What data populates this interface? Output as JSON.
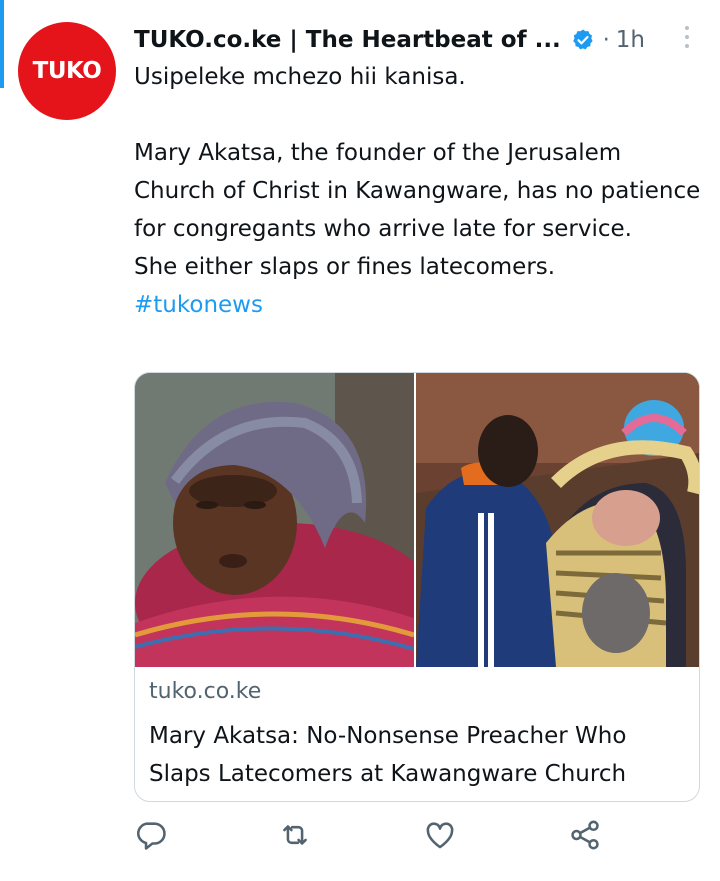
{
  "tweet": {
    "author": "TUKO.co.ke | The Heartbeat of ...",
    "avatar_text": "TUKO",
    "dot": "·",
    "time": "1h",
    "lines": [
      "Usipeleke mchezo hii kanisa.",
      "Mary Akatsa, the founder of the Jerusalem Church of Christ in Kawangware, has no patience for congregants who arrive late for service.",
      "She either slaps or fines latecomers."
    ],
    "hashtag": "#tukonews"
  },
  "card": {
    "domain": "tuko.co.ke",
    "headline": "Mary Akatsa: No-Nonsense Preacher Who Slaps Latecomers at Kawangware Church"
  },
  "icons": {
    "verified": "verified-badge-icon",
    "more": "more-options-icon",
    "reply": "reply-icon",
    "retweet": "retweet-icon",
    "like": "like-icon",
    "share": "share-icon"
  },
  "colors": {
    "brand": "#e5141b",
    "accent": "#1d9bf0",
    "muted": "#536471",
    "icon": "#536471"
  }
}
